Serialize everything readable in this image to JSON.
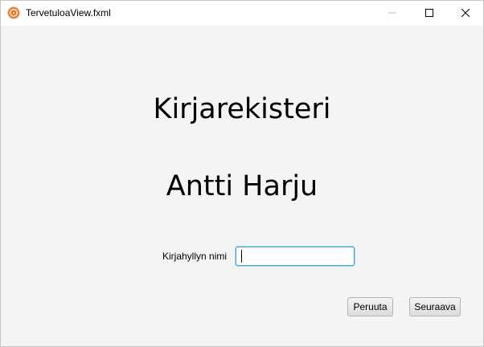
{
  "window": {
    "title": "TervetuloaView.fxml"
  },
  "main": {
    "heading": "Kirjarekisteri",
    "author": "Antti Harju",
    "field_label": "Kirjahyllyn nimi",
    "field_value": "",
    "field_placeholder": ""
  },
  "buttons": {
    "cancel_label": "Peruuta",
    "next_label": "Seuraava"
  },
  "icons": {
    "app": "app-icon",
    "minimize": "minimize-icon",
    "maximize": "maximize-icon",
    "close": "close-icon"
  },
  "colors": {
    "focus_border": "#3ca6d6",
    "app_icon": "#e8a23a"
  }
}
